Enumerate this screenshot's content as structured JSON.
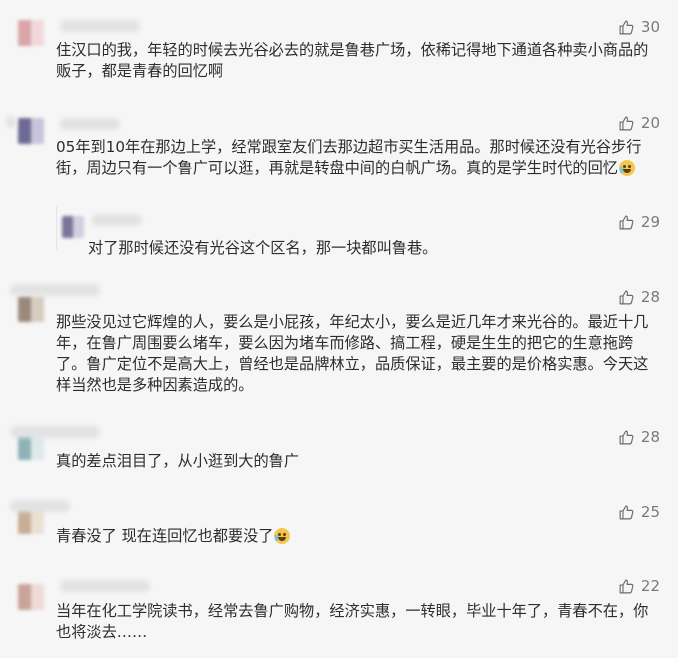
{
  "comments": [
    {
      "likes": "30",
      "text": "住汉口的我，年轻的时候去光谷必去的就是鲁巷广场，依稀记得地下通道各种卖小商品的贩子，都是青春的回忆啊",
      "avatar_colors": [
        "#d9a5a9",
        "#f1d9db"
      ]
    },
    {
      "likes": "20",
      "text": "05年到10年在那边上学，经常跟室友们去那边超市买生活用品。那时候还没有光谷步行街，周边只有一个鲁广可以逛，再就是转盘中间的白帆广场。真的是学生时代的回忆",
      "avatar_colors": [
        "#6e6a95",
        "#c7c4dc"
      ]
    },
    {
      "likes": "29",
      "text": "对了那时候还没有光谷这个区名，那一块都叫鲁巷。",
      "avatar_colors": [
        "#7b7599",
        "#d1cfe0"
      ]
    },
    {
      "likes": "28",
      "text": "那些没见过它辉煌的人，要么是小屁孩，年纪太小，要么是近几年才来光谷的。最近十几年，在鲁广周围要么堵车，要么因为堵车而修路、搞工程，硬是生生的把它的生意拖跨了。鲁广定位不是高大上，曾经也是品牌林立，品质保证，最主要的是价格实惠。今天这样当然也是多种因素造成的。",
      "avatar_colors": [
        "#9b8a7b",
        "#d8ccc0"
      ]
    },
    {
      "likes": "28",
      "text": "真的差点泪目了，从小逛到大的鲁广",
      "avatar_colors": [
        "#8fb2b7",
        "#dfe9ea"
      ]
    },
    {
      "likes": "25",
      "text": "青春没了 现在连回忆也都要没了",
      "avatar_colors": [
        "#c7ae96",
        "#ece0d3"
      ]
    },
    {
      "likes": "22",
      "text": "当年在化工学院读书，经常去鲁广购物，经济实惠，一转眼，毕业十年了，青春不在，你也将淡去……",
      "avatar_colors": [
        "#c8a49a",
        "#eedbd6"
      ]
    }
  ],
  "icons": {
    "like": "thumbs-up-icon"
  }
}
